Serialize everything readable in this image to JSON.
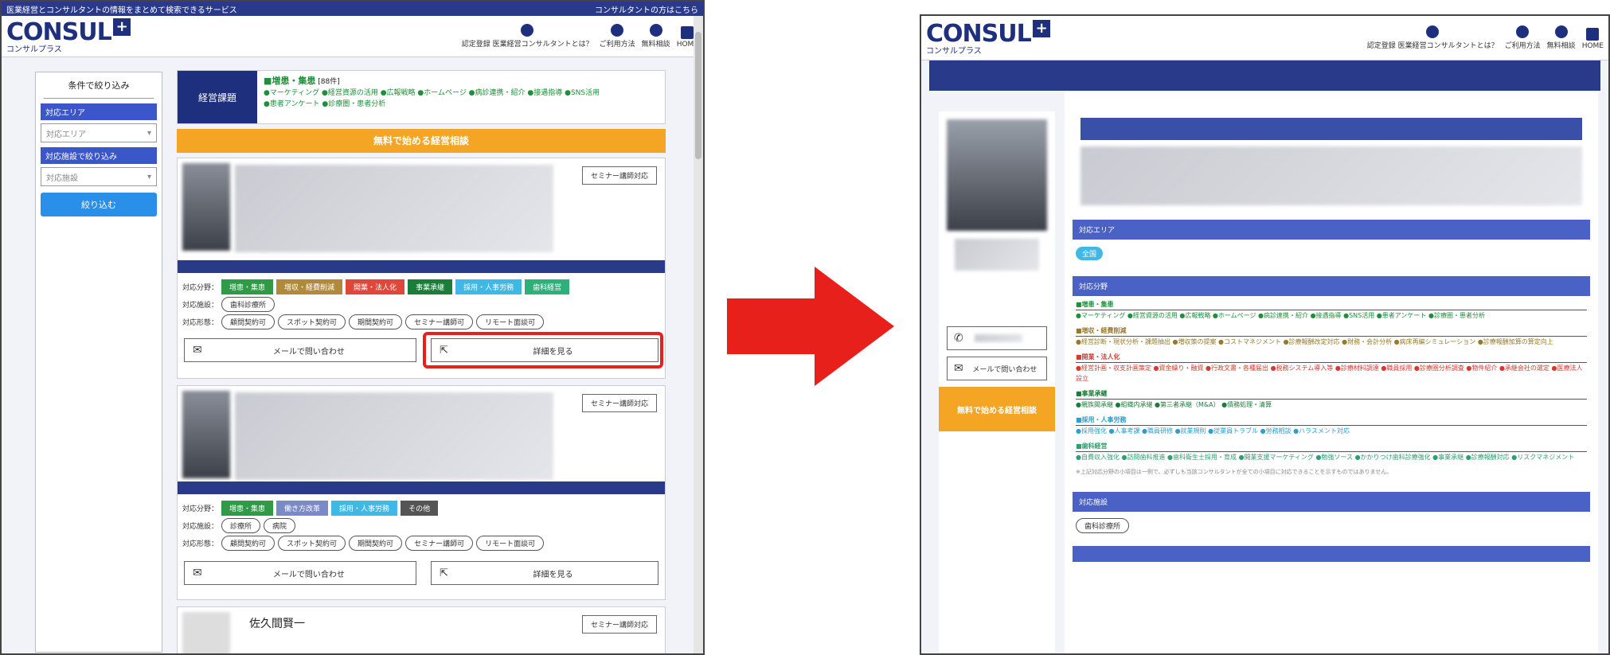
{
  "left": {
    "top_strip": {
      "left": "医業経営とコンサルタントの情報をまとめて検索できるサービス",
      "right": "コンサルタントの方はこちら"
    },
    "logo": {
      "word": "CONSUL",
      "plus": "PLUS",
      "sub": "コンサルプラス"
    },
    "nav": [
      {
        "label": "認定登録 医業経営コンサルタントとは？",
        "icon": "person-icon"
      },
      {
        "label": "ご利用方法",
        "icon": "question-icon"
      },
      {
        "label": "無料相談",
        "icon": "consult-icon"
      },
      {
        "label": "HOME",
        "icon": "home-icon"
      }
    ],
    "sidebar": {
      "title": "条件で絞り込み",
      "area_label": "対応エリア",
      "area_select": "対応エリア",
      "facility_label": "対応施設で絞り込み",
      "facility_select": "対応施設",
      "submit": "絞り込む"
    },
    "issue": {
      "label": "経営課題",
      "category": "■増患・集患",
      "category_note": "[88件]",
      "line1": "●マーケティング ●経営資源の活用 ●広報戦略 ●ホームページ ●病診連携・紹介 ●接遇指導 ●SNS活用",
      "line2": "●患者アンケート ●診療圏・患者分析"
    },
    "cta": "無料で始める経営相談",
    "cards": [
      {
        "seminar": "セミナー講師対応",
        "area_label": "対応分野：",
        "fields": [
          {
            "text": "増患・集患",
            "color": "#2e9b47"
          },
          {
            "text": "増収・経費削減",
            "color": "#b08a3a"
          },
          {
            "text": "開業・法人化",
            "color": "#e0473a"
          },
          {
            "text": "事業承継",
            "color": "#1b7d3a"
          },
          {
            "text": "採用・人事労務",
            "color": "#3fb8e6"
          },
          {
            "text": "歯科経営",
            "color": "#2fb07a"
          }
        ],
        "facility_label": "対応施設：",
        "facilities": [
          "歯科診療所"
        ],
        "form_label": "対応形態：",
        "forms": [
          "顧問契約可",
          "スポット契約可",
          "期間契約可",
          "セミナー講師可",
          "リモート面談可"
        ],
        "mail_btn": "メールで問い合わせ",
        "detail_btn": "詳細を見る"
      },
      {
        "seminar": "セミナー講師対応",
        "area_label": "対応分野：",
        "fields": [
          {
            "text": "増患・集患",
            "color": "#2e9b47"
          },
          {
            "text": "働き方改革",
            "color": "#7a8ac8"
          },
          {
            "text": "採用・人事労務",
            "color": "#3fb8e6"
          },
          {
            "text": "その他",
            "color": "#555555"
          }
        ],
        "facility_label": "対応施設：",
        "facilities": [
          "診療所",
          "病院"
        ],
        "form_label": "対応形態：",
        "forms": [
          "顧問契約可",
          "スポット契約可",
          "期間契約可",
          "セミナー講師可",
          "リモート面談可"
        ],
        "mail_btn": "メールで問い合わせ",
        "detail_btn": "詳細を見る"
      }
    ],
    "third_name": "佐久間賢一",
    "third_seminar": "セミナー講師対応"
  },
  "right": {
    "logo": {
      "word": "CONSUL",
      "plus": "PLUS",
      "sub": "コンサルプラス"
    },
    "nav": [
      {
        "label": "認定登録 医業経営コンサルタントとは？",
        "icon": "person-icon"
      },
      {
        "label": "ご利用方法",
        "icon": "question-icon"
      },
      {
        "label": "無料相談",
        "icon": "consult-icon"
      },
      {
        "label": "HOME",
        "icon": "home-icon"
      }
    ],
    "mail_btn": "メールで問い合わせ",
    "cta": "無料で始める経営相談",
    "area_head": "対応エリア",
    "area_badge": "全国",
    "field_head": "対応分野",
    "groups": [
      {
        "title": "■増患・集患",
        "items": "●マーケティング ●経営資源の活用 ●広報戦略 ●ホームページ ●病診連携・紹介 ●接遇指導 ●SNS活用 ●患者アンケート ●診療圏・患者分析"
      },
      {
        "title": "■増収・経費削減",
        "items": "●経営診断・現状分析・課題抽出 ●増収策の提案 ●コストマネジメント ●診療報酬改定対応 ●財務・会計分析 ●病床再編シミュレーション ●診療報酬加算の算定向上"
      },
      {
        "title": "■開業・法人化",
        "items": "●経営計画・収支計画策定 ●資金繰り・融資 ●行政文書・各種届出 ●税務システム導入等 ●診療材料調達 ●職員採用 ●診療圏分析調査 ●物件紹介 ●承継会社の選定 ●医療法人設立"
      },
      {
        "title": "■事業承継",
        "items": "●親族間承継 ●組織内承継 ●第三者承継（M&A） ●債務処理・清算"
      },
      {
        "title": "■採用・人事労務",
        "items": "●採用強化 ●人事考課 ●職員研修 ●就業規則 ●従業員トラブル ●労務相談 ●ハラスメント対応"
      },
      {
        "title": "■歯科経営",
        "items": "●自費収入強化 ●訪問歯科推進 ●歯科衛生士採用・育成 ●開業支援マーケティング ●勉強ソース ●かかりつけ歯科診療強化 ●事業承継 ●診療報酬対応 ●リスクマネジメント"
      }
    ],
    "footnote": "※上記対応分野の小項目は一例で、必ずしも当該コンサルタントが全ての小項目に対応できることを示すものではありません。",
    "facility_head": "対応施設",
    "facility_badge": "歯科診療所"
  },
  "colors": {
    "navy": "#1e2f7e",
    "blue": "#3a56c8",
    "orange": "#f5a524",
    "red": "#e8201c"
  }
}
